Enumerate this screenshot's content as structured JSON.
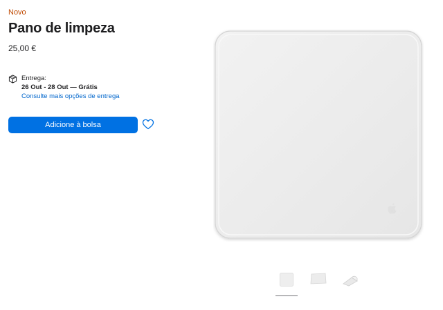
{
  "product": {
    "badge": "Novo",
    "title": "Pano de limpeza",
    "price": "25,00 €"
  },
  "delivery": {
    "icon": "package-icon",
    "label": "Entrega:",
    "dates": "26 Out - 28 Out — Grátis",
    "more_options_link": "Consulte mais opções de entrega"
  },
  "actions": {
    "add_to_bag_label": "Adicione à bolsa",
    "wishlist_icon": "heart-icon",
    "accent_color": "#0071e3"
  },
  "gallery": {
    "hero_alt": "polishing-cloth-image",
    "thumbnails": [
      {
        "name": "thumbnail-cloth-flat",
        "selected": true
      },
      {
        "name": "thumbnail-cloth-angled",
        "selected": false
      },
      {
        "name": "thumbnail-cloth-folded",
        "selected": false
      }
    ]
  },
  "colors": {
    "badge": "#bf4800",
    "link": "#0066cc",
    "text": "#1d1d1f"
  }
}
